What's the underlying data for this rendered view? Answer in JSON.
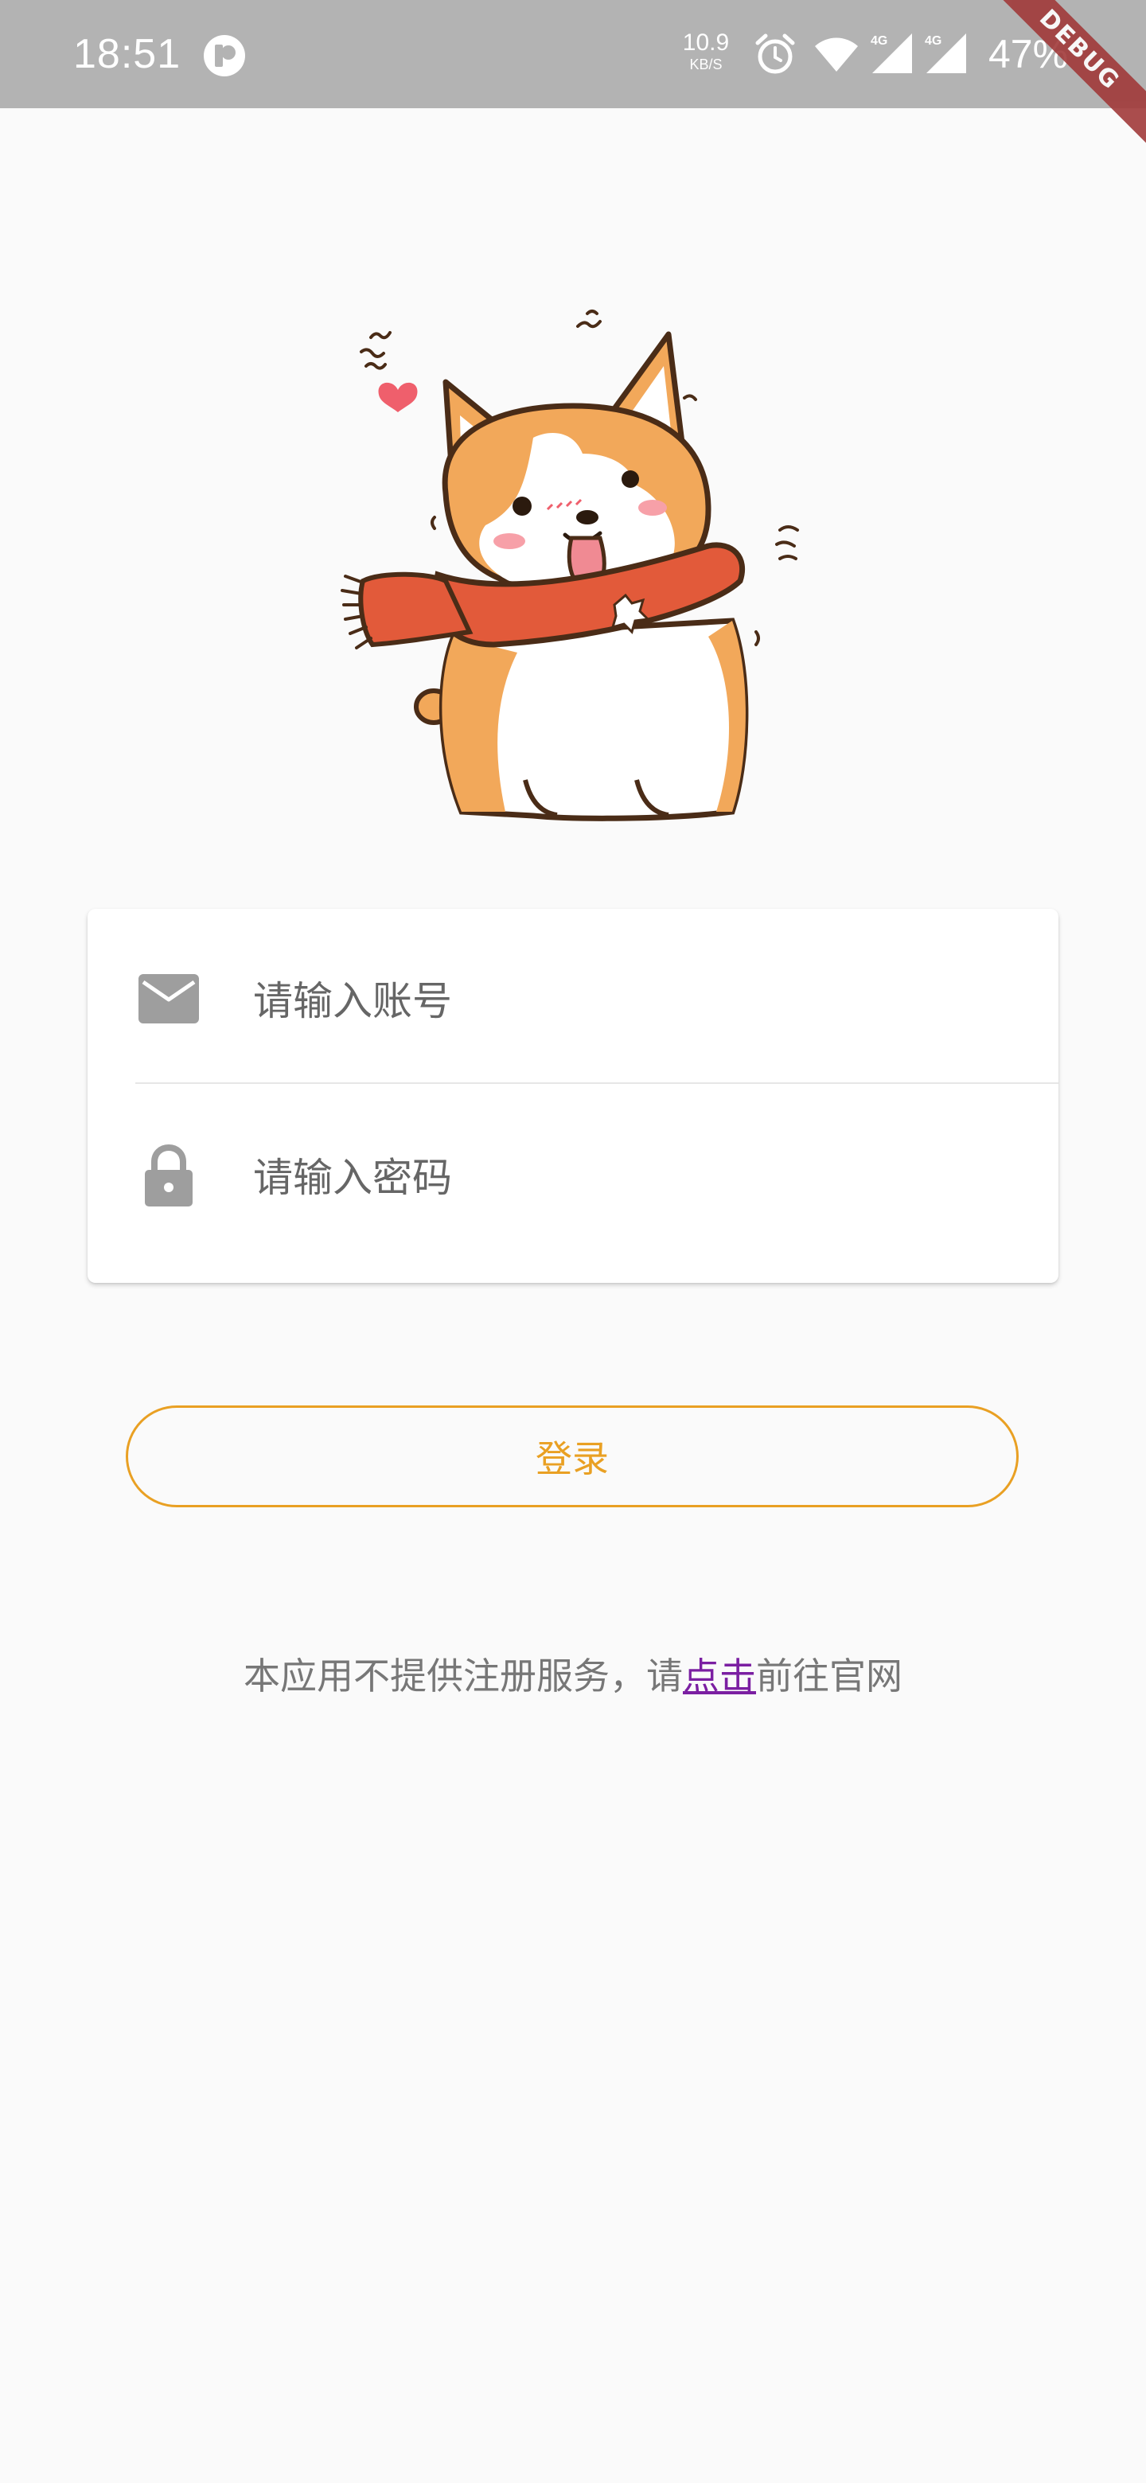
{
  "status_bar": {
    "time": "18:51",
    "net_speed_value": "10.9",
    "net_speed_unit": "KB/S",
    "signal_1_label": "4G",
    "signal_2_label": "4G",
    "battery": "47%",
    "icons": [
      "app-notification-icon",
      "alarm-icon",
      "wifi-icon",
      "signal-icon",
      "signal-icon"
    ]
  },
  "debug_banner": "DEBUG",
  "login_form": {
    "account_placeholder": "请输入账号",
    "password_placeholder": "请输入密码",
    "account_icon": "mail-icon",
    "password_icon": "lock-icon"
  },
  "login_button": {
    "label": "登录"
  },
  "notice": {
    "prefix": "本应用不提供注册服务，请",
    "link": "点击",
    "suffix": "前往官网"
  },
  "colors": {
    "accent": "#e9a023",
    "link": "#7b1fa2",
    "status_bar": "#b3b3b3",
    "background": "#fafafa"
  }
}
